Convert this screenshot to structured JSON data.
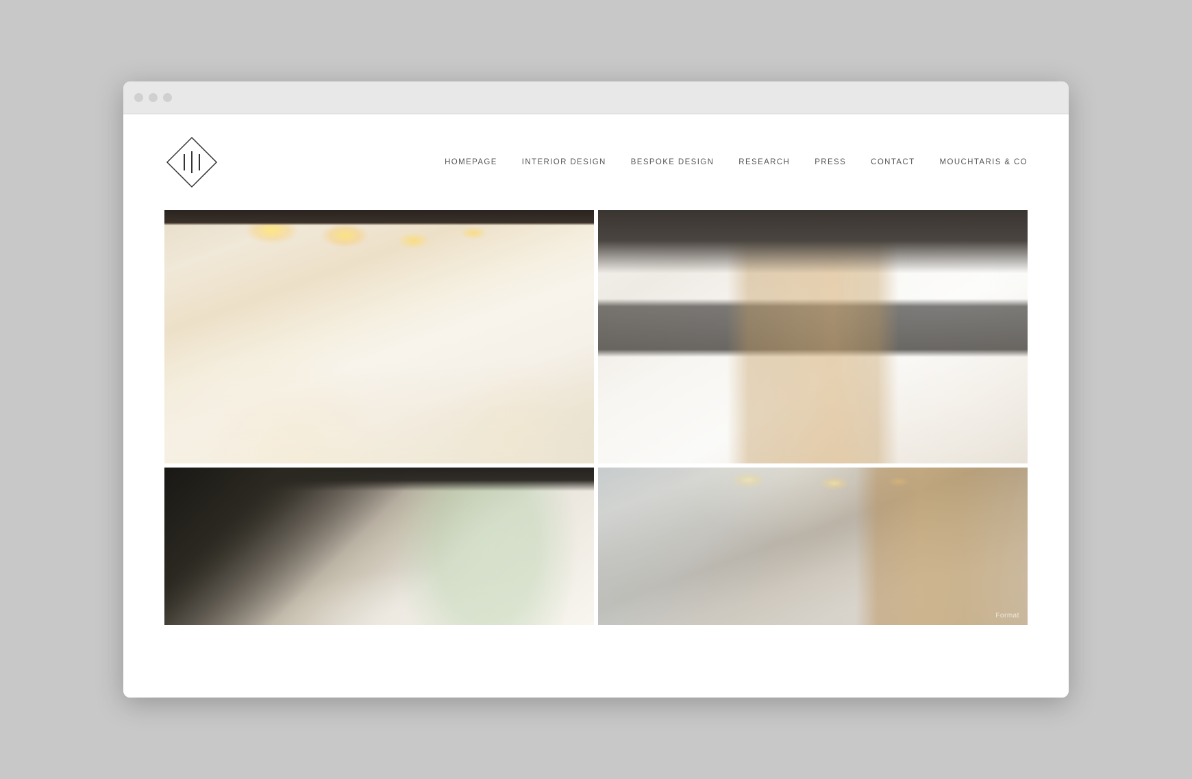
{
  "browser": {
    "dots": [
      "dot1",
      "dot2",
      "dot3"
    ]
  },
  "header": {
    "logo_alt": "111 Studio Logo"
  },
  "nav": {
    "items": [
      {
        "id": "homepage",
        "label": "HOMEPAGE"
      },
      {
        "id": "interior-design",
        "label": "INTERIOR DESIGN"
      },
      {
        "id": "bespoke-design",
        "label": "BESPOKE DESIGN"
      },
      {
        "id": "research",
        "label": "RESEARCH"
      },
      {
        "id": "press",
        "label": "PRESS"
      },
      {
        "id": "contact",
        "label": "CONTACT"
      },
      {
        "id": "mouchtaris-co",
        "label": "MOUCHTARIS & CO"
      }
    ]
  },
  "gallery": {
    "rooms": [
      {
        "id": "room-1",
        "alt": "Modern dining room with warm pendant lights, wooden dining table and white chairs",
        "position": "top-left"
      },
      {
        "id": "room-2",
        "alt": "Open plan kitchen and living room with wood cabinets and mezzanine",
        "position": "top-right"
      },
      {
        "id": "room-3",
        "alt": "Entrance hallway with dark staircase and bright window",
        "position": "bottom-left"
      },
      {
        "id": "room-4",
        "alt": "Interior detail with glass balustrade and wood paneling, recessed ceiling lights",
        "position": "bottom-right"
      }
    ],
    "watermark": "Format"
  }
}
